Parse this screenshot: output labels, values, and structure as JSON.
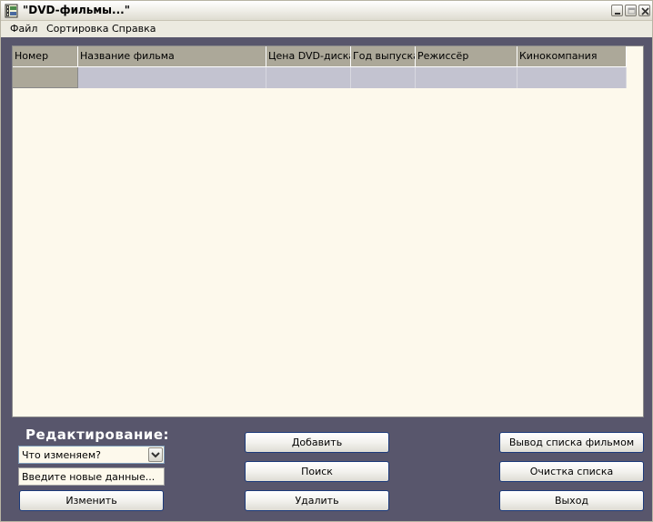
{
  "window": {
    "title": "\"DVD-фильмы...\""
  },
  "menu": [
    "Файл",
    "Сортировка",
    "Справка"
  ],
  "grid": {
    "columns": [
      "Номер",
      "Название фильма",
      "Цена DVD-диска",
      "Год выпуска",
      "Режиссёр",
      "Кинокомпания"
    ]
  },
  "edit": {
    "section_label": "Редактирование:",
    "field_select_value": "Что изменяем?",
    "new_data_placeholder": "Введите новые данные...",
    "change_button": "Изменить"
  },
  "actions": {
    "add_button": "Добавить",
    "search_button": "Поиск",
    "delete_button": "Удалить",
    "list_button": "Вывод списка фильмом",
    "clear_button": "Очистка списка",
    "exit_button": "Выход"
  },
  "colors": {
    "background": "#58566c",
    "grid_background": "#fdf9ec",
    "header": "#aca899",
    "row": "#c3c3d0",
    "button_border": "#1c3a7a"
  }
}
